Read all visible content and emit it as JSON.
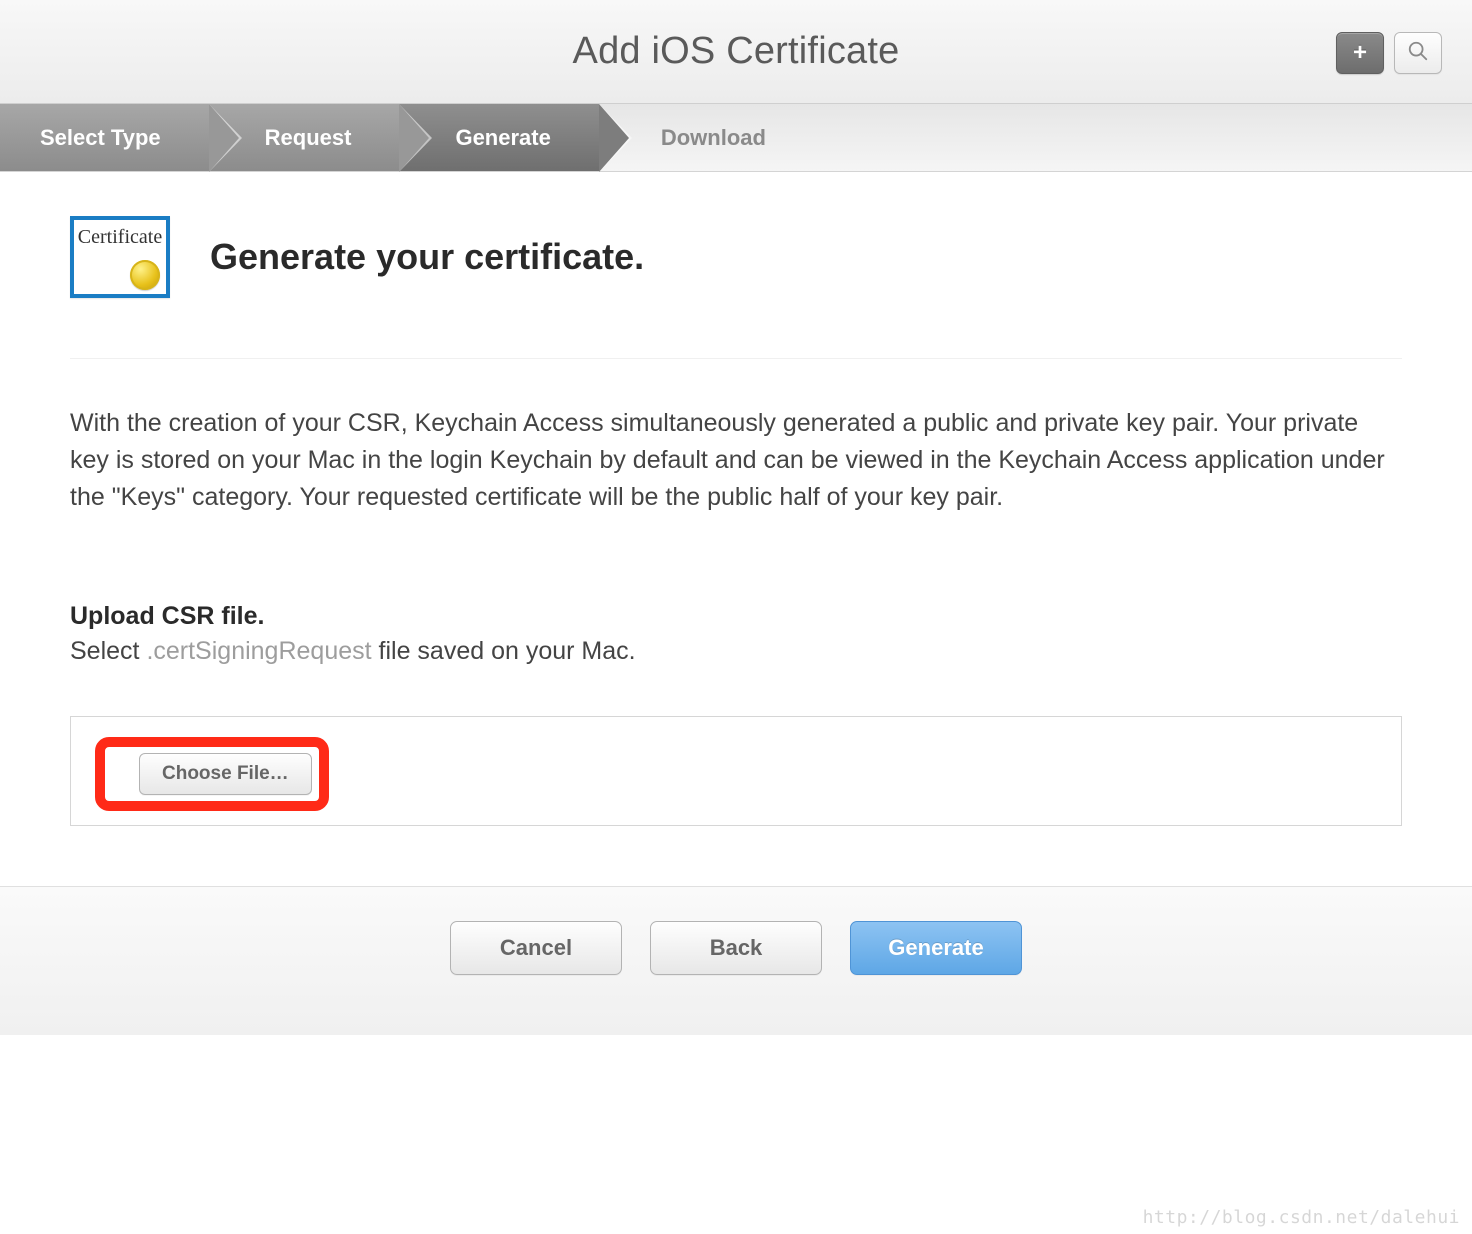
{
  "header": {
    "title": "Add iOS Certificate"
  },
  "steps": {
    "select_type": "Select Type",
    "request": "Request",
    "generate": "Generate",
    "download": "Download"
  },
  "icon": {
    "word": "Certificate"
  },
  "page_title": "Generate your certificate.",
  "description": "With the creation of your CSR, Keychain Access simultaneously generated a public and private key pair. Your private key is stored on your Mac in the login Keychain by default and can be viewed in the Keychain Access application under the \"Keys\" category. Your requested certificate will be the public half of your key pair.",
  "upload": {
    "heading": "Upload CSR file.",
    "sub_prefix": "Select ",
    "sub_ext": ".certSigningRequest",
    "sub_suffix": " file saved on your Mac.",
    "choose_label": "Choose File…"
  },
  "footer": {
    "cancel": "Cancel",
    "back": "Back",
    "generate": "Generate"
  },
  "watermark": "http://blog.csdn.net/dalehui"
}
